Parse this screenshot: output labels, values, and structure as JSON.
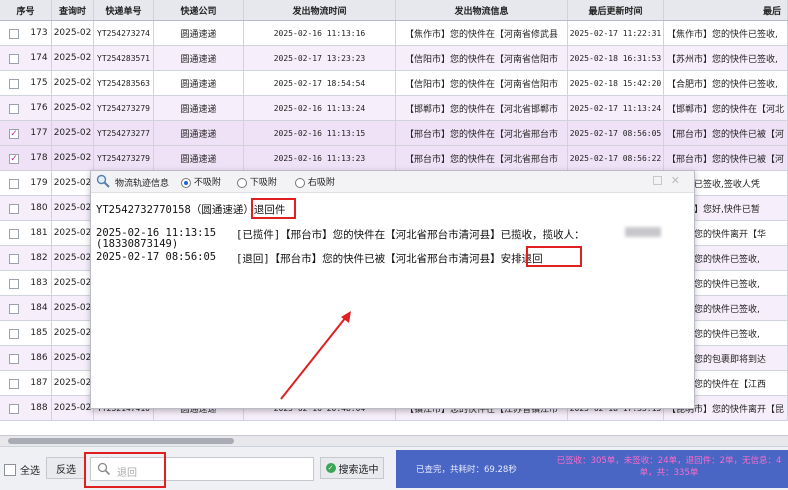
{
  "columns": [
    "序号",
    "查询时",
    "快递单号",
    "快递公司",
    "发出物流时间",
    "发出物流信息",
    "最后更新时间",
    "最后"
  ],
  "rows": [
    {
      "seq": "173",
      "qt": "2025-02",
      "tn": "YT254273274",
      "co": "圆通速递",
      "st": "2025-02-16 11:13:16",
      "si": "【焦作市】您的快件在【河南省修武县",
      "ut": "2025-02-17 11:22:31",
      "ui": "【焦作市】您的快件已签收,",
      "checked": false
    },
    {
      "seq": "174",
      "qt": "2025-02",
      "tn": "YT254283571",
      "co": "圆通速递",
      "st": "2025-02-17 13:23:23",
      "si": "【信阳市】您的快件在【河南省信阳市",
      "ut": "2025-02-18 16:31:53",
      "ui": "【苏州市】您的快件已签收,",
      "checked": false
    },
    {
      "seq": "175",
      "qt": "2025-02",
      "tn": "YT254283563",
      "co": "圆通速递",
      "st": "2025-02-17 18:54:54",
      "si": "【信阳市】您的快件在【河南省信阳市",
      "ut": "2025-02-18 15:42:20",
      "ui": "【合肥市】您的快件已签收,",
      "checked": false
    },
    {
      "seq": "176",
      "qt": "2025-02",
      "tn": "YT254273279",
      "co": "圆通速递",
      "st": "2025-02-16 11:13:24",
      "si": "【邯郸市】您的快件在【河北省邯郸市",
      "ut": "2025-02-17 11:13:24",
      "ui": "【邯郸市】您的快件在【河北",
      "checked": false
    },
    {
      "seq": "177",
      "qt": "2025-02",
      "tn": "YT254273277",
      "co": "圆通速递",
      "st": "2025-02-16 11:13:15",
      "si": "【邢台市】您的快件在【河北省邢台市",
      "ut": "2025-02-17 08:56:05",
      "ui": "【邢台市】您的快件已被【河",
      "checked": true
    },
    {
      "seq": "178",
      "qt": "2025-02",
      "tn": "YT254273279",
      "co": "圆通速递",
      "st": "2025-02-16 11:13:23",
      "si": "【邢台市】您的快件在【河北省邢台市",
      "ut": "2025-02-17 08:56:22",
      "ui": "【邢台市】您的快件已被【河",
      "checked": true
    },
    {
      "seq": "179",
      "qt": "2025-02",
      "tn": "",
      "co": "",
      "st": "",
      "si": "",
      "ut": "",
      "ui": "定市】已签收,签收人凭",
      "checked": false
    },
    {
      "seq": "180",
      "qt": "2025-02",
      "tn": "",
      "co": "",
      "st": "",
      "si": "",
      "ut": "",
      "ui": "家庄市】您好,快件已暂",
      "checked": false
    },
    {
      "seq": "181",
      "qt": "2025-02",
      "tn": "",
      "co": "",
      "st": "",
      "si": "",
      "ut": "",
      "ui": "州市】您的快件离开【华",
      "checked": false
    },
    {
      "seq": "182",
      "qt": "2025-02",
      "tn": "",
      "co": "",
      "st": "",
      "si": "",
      "ut": "",
      "ui": "山市】您的快件已签收,",
      "checked": false
    },
    {
      "seq": "183",
      "qt": "2025-02",
      "tn": "",
      "co": "",
      "st": "",
      "si": "",
      "ut": "",
      "ui": "头市】您的快件已签收,",
      "checked": false
    },
    {
      "seq": "184",
      "qt": "2025-02",
      "tn": "",
      "co": "",
      "st": "",
      "si": "",
      "ut": "",
      "ui": "州市】您的快件已签收,",
      "checked": false
    },
    {
      "seq": "185",
      "qt": "2025-02",
      "tn": "",
      "co": "",
      "st": "",
      "si": "",
      "ut": "",
      "ui": "海市】您的快件已签收,",
      "checked": false
    },
    {
      "seq": "186",
      "qt": "2025-02",
      "tn": "",
      "co": "",
      "st": "",
      "si": "",
      "ut": "",
      "ui": "州市】您的包裹即将到达",
      "checked": false
    },
    {
      "seq": "187",
      "qt": "2025-02",
      "tn": "",
      "co": "",
      "st": "",
      "si": "",
      "ut": "",
      "ui": "旋市】您的快件在【江西",
      "checked": false
    },
    {
      "seq": "188",
      "qt": "2025-02",
      "tn": "YT252147410",
      "co": "圆通速递",
      "st": "2025-02-16 20:48:04",
      "si": "【镇江市】您的快件在【江苏省镇江市",
      "ut": "2025-02-18 17:35:15",
      "ui": "【昆明市】您的快件离开【昆",
      "checked": false
    }
  ],
  "popup": {
    "title": "物流轨迹信息",
    "radio": [
      "不吸附",
      "下吸附",
      "右吸附"
    ],
    "header_text": "YT2542732770158（圆通速递）",
    "header_tag": "退回件",
    "line1_time": "2025-02-16 11:13:15",
    "line1_text": "[已揽件]【邢台市】您的快件在【河北省邢台市清河县】已揽收，揽收人：",
    "line1_phone": "(18330873149)",
    "line2_time": "2025-02-17 08:56:05",
    "line2_text": "[退回]【邢台市】您的快件已被【河北省邢台市清河县】",
    "line2_tag": "安排退回"
  },
  "footer": {
    "select_all": "全选",
    "invert": "反选",
    "search_placeholder": "退回",
    "search_btn": "搜索选中",
    "status1": "已查完，共耗时：69.28秒",
    "status2": "已签收：305单，未签收：24单，退回件：2单，无信息：4单，共：335单"
  }
}
